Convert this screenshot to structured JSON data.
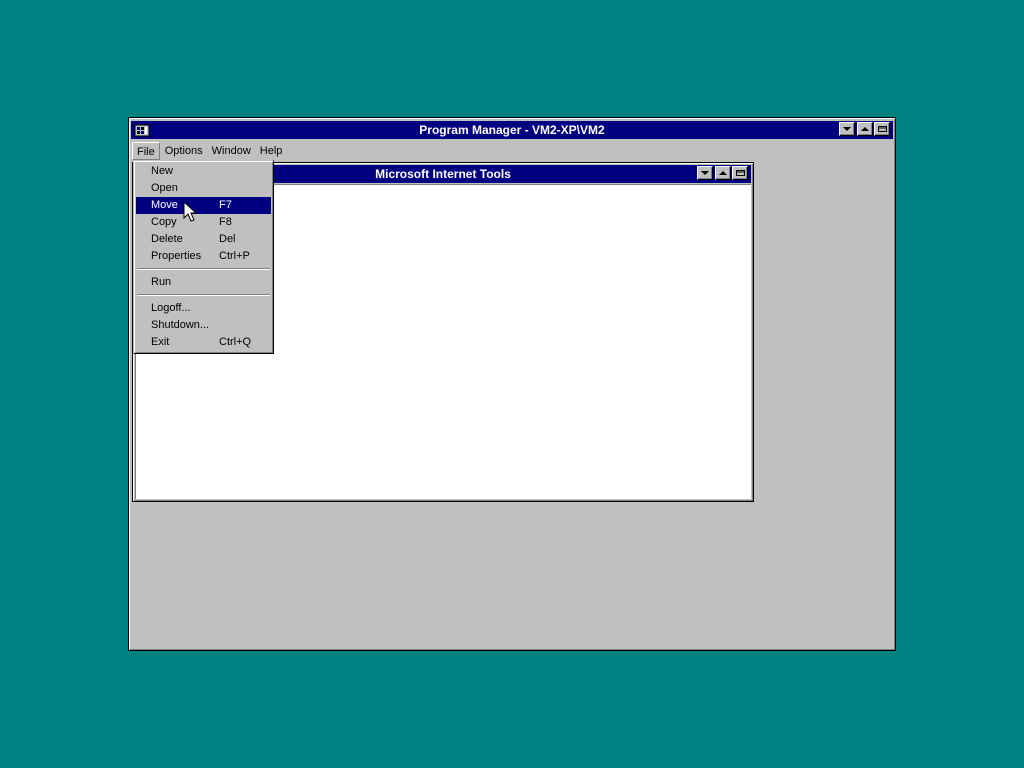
{
  "desktop": {
    "background_color": "#008080"
  },
  "program_manager": {
    "title": "Program Manager - VM2-XP\\VM2",
    "titlebar_color": "#000080",
    "menubar": [
      {
        "label": "File"
      },
      {
        "label": "Options"
      },
      {
        "label": "Window"
      },
      {
        "label": "Help"
      }
    ],
    "caption_buttons": {
      "minimize_icon": "down-arrow-icon",
      "maximize_icon": "up-arrow-icon",
      "restore_icon": "restore-icon"
    }
  },
  "group_window": {
    "title": "Microsoft Internet Tools"
  },
  "file_menu": {
    "items": [
      {
        "label": "New",
        "shortcut": ""
      },
      {
        "label": "Open",
        "shortcut": ""
      },
      {
        "label": "Move",
        "shortcut": "F7",
        "highlighted": true
      },
      {
        "label": "Copy",
        "shortcut": "F8"
      },
      {
        "label": "Delete",
        "shortcut": "Del"
      },
      {
        "label": "Properties",
        "shortcut": "Ctrl+P"
      },
      {
        "label": "Run",
        "shortcut": ""
      },
      {
        "label": "Logoff...",
        "shortcut": ""
      },
      {
        "label": "Shutdown...",
        "shortcut": ""
      },
      {
        "label": "Exit",
        "shortcut": "Ctrl+Q"
      }
    ]
  },
  "highlight_color": "#000080"
}
